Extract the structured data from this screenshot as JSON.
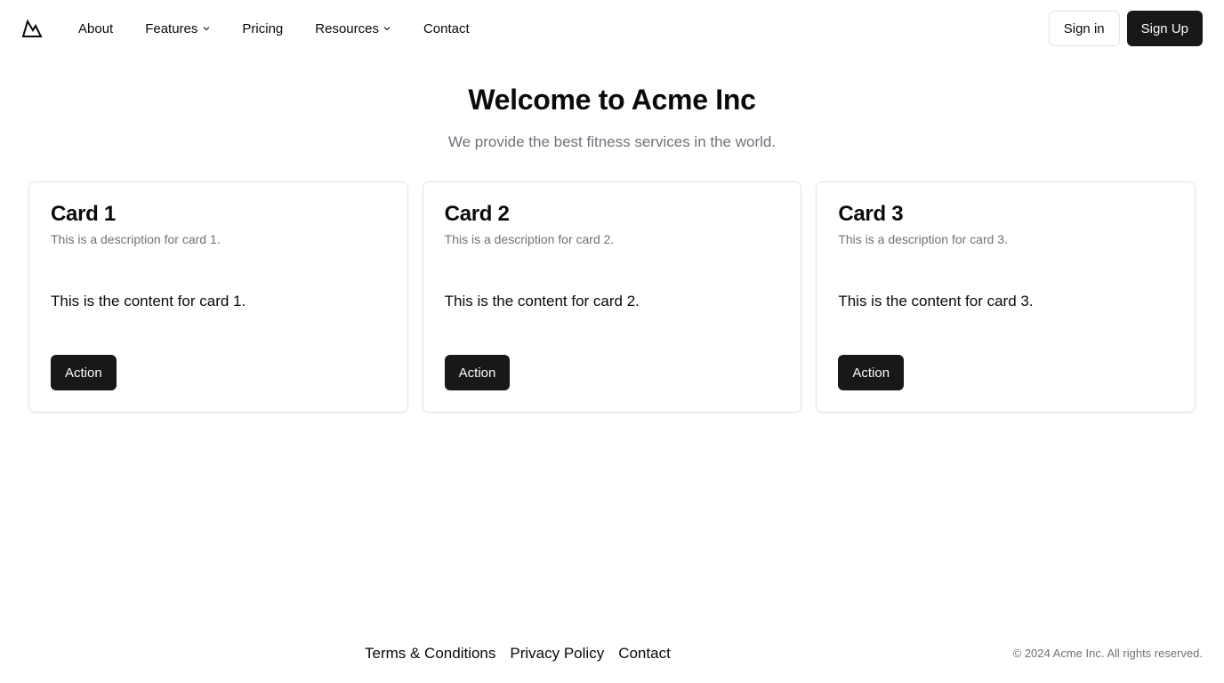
{
  "header": {
    "logo_icon": "mountain-icon",
    "nav": [
      {
        "label": "About",
        "has_dropdown": false
      },
      {
        "label": "Features",
        "has_dropdown": true
      },
      {
        "label": "Pricing",
        "has_dropdown": false
      },
      {
        "label": "Resources",
        "has_dropdown": true
      },
      {
        "label": "Contact",
        "has_dropdown": false
      }
    ],
    "sign_in_label": "Sign in",
    "sign_up_label": "Sign Up"
  },
  "hero": {
    "title": "Welcome to Acme Inc",
    "subtitle": "We provide the best fitness services in the world."
  },
  "cards": [
    {
      "title": "Card 1",
      "description": "This is a description for card 1.",
      "content": "This is the content for card 1.",
      "action_label": "Action"
    },
    {
      "title": "Card 2",
      "description": "This is a description for card 2.",
      "content": "This is the content for card 2.",
      "action_label": "Action"
    },
    {
      "title": "Card 3",
      "description": "This is a description for card 3.",
      "content": "This is the content for card 3.",
      "action_label": "Action"
    }
  ],
  "footer": {
    "links": [
      "Terms & Conditions",
      "Privacy Policy",
      "Contact"
    ],
    "copyright": "© 2024 Acme Inc. All rights reserved."
  },
  "colors": {
    "primary": "#18181b",
    "muted_text": "#71717a",
    "border": "#e4e4e7",
    "background": "#ffffff"
  }
}
